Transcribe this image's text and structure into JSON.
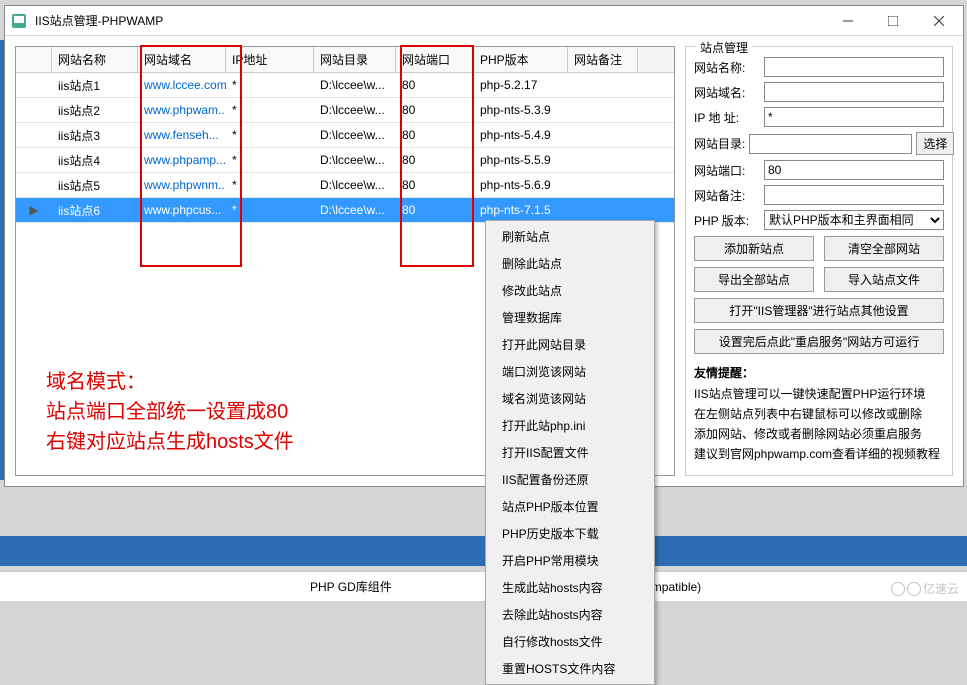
{
  "window": {
    "title": "IIS站点管理-PHPWAMP"
  },
  "table": {
    "headers": [
      "网站名称",
      "网站域名",
      "IP地址",
      "网站目录",
      "网站端口",
      "PHP版本",
      "网站备注"
    ],
    "rows": [
      {
        "name": "iis站点1",
        "domain": "www.lccee.com",
        "ip": "*",
        "dir": "D:\\lccee\\w...",
        "port": "80",
        "php": "php-5.2.17",
        "remark": ""
      },
      {
        "name": "iis站点2",
        "domain": "www.phpwam...",
        "ip": "*",
        "dir": "D:\\lccee\\w...",
        "port": "80",
        "php": "php-nts-5.3.9",
        "remark": ""
      },
      {
        "name": "iis站点3",
        "domain": "www.fenseh...",
        "ip": "*",
        "dir": "D:\\lccee\\w...",
        "port": "80",
        "php": "php-nts-5.4.9",
        "remark": ""
      },
      {
        "name": "iis站点4",
        "domain": "www.phpamp...",
        "ip": "*",
        "dir": "D:\\lccee\\w...",
        "port": "80",
        "php": "php-nts-5.5.9",
        "remark": ""
      },
      {
        "name": "iis站点5",
        "domain": "www.phpwnm...",
        "ip": "*",
        "dir": "D:\\lccee\\w...",
        "port": "80",
        "php": "php-nts-5.6.9",
        "remark": ""
      },
      {
        "name": "iis站点6",
        "domain": "www.phpcus...",
        "ip": "*",
        "dir": "D:\\lccee\\w...",
        "port": "80",
        "php": "php-nts-7.1.5",
        "remark": ""
      }
    ],
    "selected_index": 5
  },
  "annotation": {
    "line1": "域名模式：",
    "line2": "站点端口全部统一设置成80",
    "line3": "右键对应站点生成hosts文件"
  },
  "context_menu": {
    "items": [
      "刷新站点",
      "删除此站点",
      "修改此站点",
      "管理数据库",
      "打开此网站目录",
      "端口浏览该网站",
      "域名浏览该网站",
      "打开此站php.ini",
      "打开IIS配置文件",
      "IIS配置备份还原",
      "站点PHP版本位置",
      "PHP历史版本下载",
      "开启PHP常用模块",
      "生成此站hosts内容",
      "去除此站hosts内容",
      "自行修改hosts文件",
      "重置HOSTS文件内容"
    ]
  },
  "sidebar": {
    "legend": "站点管理",
    "form": {
      "site_name": {
        "label": "网站名称:",
        "value": ""
      },
      "domain": {
        "label": "网站域名:",
        "value": ""
      },
      "ip": {
        "label": "IP 地 址:",
        "value": "*"
      },
      "dir": {
        "label": "网站目录:",
        "value": "",
        "browse": "选择"
      },
      "port": {
        "label": "网站端口:",
        "value": "80"
      },
      "remark": {
        "label": "网站备注:",
        "value": ""
      },
      "php": {
        "label": "PHP 版本:",
        "value": "默认PHP版本和主界面相同"
      }
    },
    "buttons": {
      "add": "添加新站点",
      "clear": "清空全部网站",
      "export": "导出全部站点",
      "import": "导入站点文件",
      "iismgr": "打开\"IIS管理器\"进行站点其他设置",
      "restart": "设置完后点此\"重启服务\"网站方可运行"
    },
    "hints": {
      "title": "友情提醒：",
      "l1": "IIS站点管理可以一键快速配置PHP运行环境",
      "l2": "在左侧站点列表中右键鼠标可以修改或删除",
      "l3": "添加网站、修改或者删除网站必须重启服务",
      "l4": "建议到官网phpwamp.com查看详细的视频教程"
    }
  },
  "bottom": {
    "gd": "PHP GD库组件",
    "compat": "mpatible)"
  },
  "watermark": "亿速云"
}
